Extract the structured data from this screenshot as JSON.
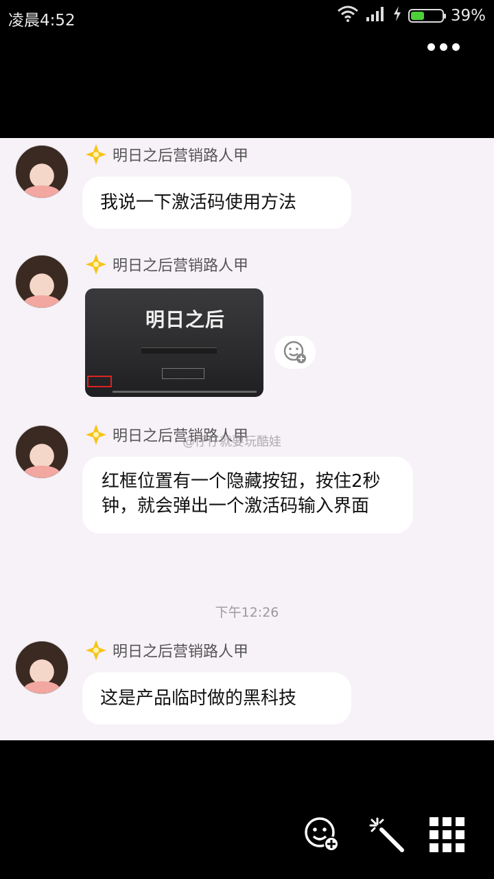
{
  "status_bar": {
    "time": "凌晨4:52",
    "battery": "39%",
    "battery_level": 0.39
  },
  "header": {
    "more_icon": "more-icon"
  },
  "messages": [
    {
      "sender": "明日之后营销路人甲",
      "text": "我说一下激活码使用方法"
    },
    {
      "sender": "明日之后营销路人甲",
      "image_title": "明日之后"
    },
    {
      "sender": "明日之后营销路人甲",
      "text": "红框位置有一个隐藏按钮，按住2秒钟，就会弹出一个激活码输入界面"
    },
    {
      "sender": "明日之后营销路人甲",
      "text": "这是产品临时做的黑科技"
    }
  ],
  "timestamp": "下午12:26",
  "watermark": "@仔仔就要玩酷娃",
  "toolbar": {
    "icons": [
      "emoji-add-icon",
      "magic-wand-icon",
      "grid-apps-icon"
    ]
  }
}
